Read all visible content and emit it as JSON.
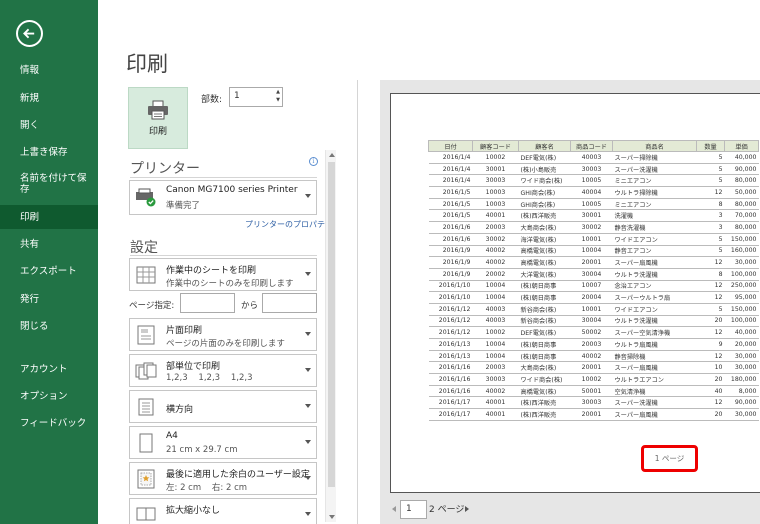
{
  "sidebar": {
    "items": [
      {
        "label": "情報"
      },
      {
        "label": "新規"
      },
      {
        "label": "開く"
      },
      {
        "label": "上書き保存"
      },
      {
        "label": "名前を付けて保存"
      },
      {
        "label": "印刷"
      },
      {
        "label": "共有"
      },
      {
        "label": "エクスポート"
      },
      {
        "label": "発行"
      },
      {
        "label": "閉じる"
      },
      {
        "label": "アカウント"
      },
      {
        "label": "オプション"
      },
      {
        "label": "フィードバック"
      }
    ]
  },
  "print": {
    "title": "印刷",
    "button_label": "印刷",
    "copies_label": "部数:",
    "copies_value": "1"
  },
  "printer": {
    "heading": "プリンター",
    "name": "Canon MG7100 series Printer",
    "status": "準備完了",
    "properties_link": "プリンターのプロパティ"
  },
  "settings": {
    "heading": "設定",
    "print_what": {
      "line1": "作業中のシートを印刷",
      "line2": "作業中のシートのみを印刷します"
    },
    "page_range_label": "ページ指定:",
    "page_range_to": "から",
    "sides": {
      "line1": "片面印刷",
      "line2": "ページの片面のみを印刷します"
    },
    "collate": {
      "line1": "部単位で印刷",
      "line2": "1,2,3    1,2,3    1,2,3"
    },
    "orientation": {
      "line1": "横方向"
    },
    "paper": {
      "line1": "A4",
      "line2": "21 cm x 29.7 cm"
    },
    "margins": {
      "line1": "最後に適用した余白のユーザー設定",
      "line2": "左: 2 cm    右: 2 cm"
    },
    "scaling": {
      "line1": "拡大縮小なし"
    }
  },
  "preview": {
    "headers": [
      "日付",
      "顧客コード",
      "顧客名",
      "商品コード",
      "商品名",
      "数量",
      "単価"
    ],
    "rows": [
      [
        "2016/1/4",
        "10002",
        "DEF電気(株)",
        "40003",
        "スーパー掃除機",
        "5",
        "40,000"
      ],
      [
        "2016/1/4",
        "30001",
        "(株)小島販売",
        "30003",
        "スーパー洗濯機",
        "5",
        "90,000"
      ],
      [
        "2016/1/4",
        "30003",
        "ワイド商会(株)",
        "10005",
        "ミニエアコン",
        "5",
        "80,000"
      ],
      [
        "2016/1/5",
        "10003",
        "GHI商会(株)",
        "40004",
        "ウルトラ掃除機",
        "12",
        "50,000"
      ],
      [
        "2016/1/5",
        "10003",
        "GHI商会(株)",
        "10005",
        "ミニエアコン",
        "8",
        "80,000"
      ],
      [
        "2016/1/5",
        "40001",
        "(株)西洋販売",
        "30001",
        "洗濯機",
        "3",
        "70,000"
      ],
      [
        "2016/1/6",
        "20003",
        "大島商会(株)",
        "30002",
        "静音洗濯機",
        "3",
        "80,000"
      ],
      [
        "2016/1/6",
        "30002",
        "海洋電気(株)",
        "10001",
        "ワイドエアコン",
        "5",
        "150,000"
      ],
      [
        "2016/1/9",
        "40002",
        "高橋電気(株)",
        "10004",
        "静音エアコン",
        "5",
        "160,000"
      ],
      [
        "2016/1/9",
        "40002",
        "高橋電気(株)",
        "20001",
        "スーパー扇風機",
        "12",
        "30,000"
      ],
      [
        "2016/1/9",
        "20002",
        "大洋電気(株)",
        "30004",
        "ウルトラ洗濯機",
        "8",
        "100,000"
      ],
      [
        "2016/1/10",
        "10004",
        "(株)朝日商事",
        "10007",
        "念治エアコン",
        "12",
        "250,000"
      ],
      [
        "2016/1/10",
        "10004",
        "(株)朝日商事",
        "20004",
        "スーパーウルトラ扇",
        "12",
        "95,000"
      ],
      [
        "2016/1/12",
        "40003",
        "新谷商会(株)",
        "10001",
        "ワイドエアコン",
        "5",
        "150,000"
      ],
      [
        "2016/1/12",
        "40003",
        "新谷商会(株)",
        "30004",
        "ウルトラ洗濯機",
        "20",
        "100,000"
      ],
      [
        "2016/1/12",
        "10002",
        "DEF電気(株)",
        "50002",
        "スーパー空気清浄機",
        "12",
        "40,000"
      ],
      [
        "2016/1/13",
        "10004",
        "(株)朝日商事",
        "20003",
        "ウルトラ扇風機",
        "9",
        "20,000"
      ],
      [
        "2016/1/13",
        "10004",
        "(株)朝日商事",
        "40002",
        "静音掃除機",
        "12",
        "30,000"
      ],
      [
        "2016/1/16",
        "20003",
        "大島商会(株)",
        "20001",
        "スーパー扇風機",
        "10",
        "30,000"
      ],
      [
        "2016/1/16",
        "30003",
        "ワイド商会(株)",
        "10002",
        "ウルトラエアコン",
        "20",
        "180,000"
      ],
      [
        "2016/1/16",
        "40002",
        "高橋電気(株)",
        "50001",
        "空気清浄機",
        "40",
        "8,000"
      ],
      [
        "2016/1/17",
        "40001",
        "(株)西洋販売",
        "30003",
        "スーパー洗濯機",
        "12",
        "90,000"
      ],
      [
        "2016/1/17",
        "40001",
        "(株)西洋販売",
        "20001",
        "スーパー扇風機",
        "20",
        "30,000"
      ]
    ],
    "page_label": "1 ページ"
  },
  "pager": {
    "current": "1",
    "total": "2 ページ"
  },
  "colors": {
    "sidebar": "#217346",
    "active": "#0f5a2f",
    "highlight": "#ee0000"
  }
}
